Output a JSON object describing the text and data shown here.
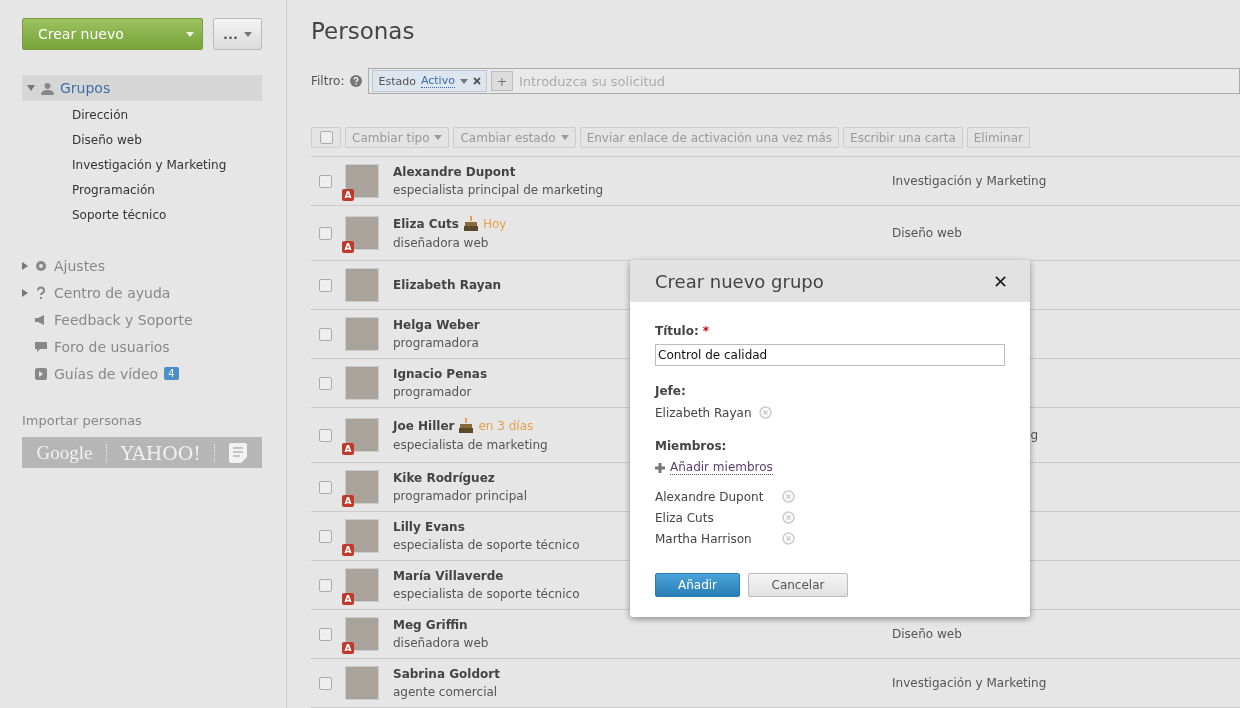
{
  "sidebar": {
    "create_button": "Crear nuevo",
    "more_button": "...",
    "groups": {
      "label": "Grupos",
      "expanded": true,
      "children": [
        {
          "label": "Dirección"
        },
        {
          "label": "Diseño web"
        },
        {
          "label": "Investigación y Marketing"
        },
        {
          "label": "Programación"
        },
        {
          "label": "Soporte técnico"
        }
      ]
    },
    "links": [
      {
        "kind": "settings",
        "label": "Ajustes",
        "expandable": true
      },
      {
        "kind": "help",
        "label": "Centro de ayuda",
        "expandable": true
      },
      {
        "kind": "feedback",
        "label": "Feedback y Soporte",
        "expandable": false
      },
      {
        "kind": "forum",
        "label": "Foro de usuarios",
        "expandable": false
      },
      {
        "kind": "video",
        "label": "Guías de vídeo",
        "expandable": false,
        "count": "4"
      }
    ],
    "import": {
      "label": "Importar personas",
      "sources": [
        "Google",
        "YAHOO!"
      ]
    }
  },
  "page": {
    "title": "Personas",
    "filter": {
      "label": "Filtro:",
      "tag": {
        "name": "Estado",
        "value": "Activo"
      },
      "add_button": "+",
      "placeholder": "Introduzca su solicitud"
    },
    "select_all": {
      "checked": false
    },
    "toolbar": [
      {
        "label": "Cambiar tipo",
        "dropdown": true
      },
      {
        "label": "Cambiar estado",
        "dropdown": true
      },
      {
        "label": "Enviar enlace de activación una vez más",
        "dropdown": false
      },
      {
        "label": "Escribir una carta",
        "dropdown": false
      },
      {
        "label": "Eliminar",
        "dropdown": false
      }
    ],
    "people": [
      {
        "name": "Alexandre Dupont",
        "role": "especialista principal de marketing",
        "badge": "A",
        "department": "Investigación y Marketing",
        "checked": false
      },
      {
        "name": "Eliza Cuts",
        "birthday": "Hoy",
        "role": "diseñadora web",
        "badge": "A",
        "department": "Diseño web",
        "checked": false
      },
      {
        "name": "Elizabeth Rayan",
        "checked": false
      },
      {
        "name": "Helga Weber",
        "role": "programadora",
        "checked": false
      },
      {
        "name": "Ignacio Penas",
        "role": "programador",
        "checked": false
      },
      {
        "name": "Joe Hiller",
        "birthday": "en 3 días",
        "role": "especialista de marketing",
        "badge": "A",
        "department": "g",
        "department_clipped": true,
        "checked": false
      },
      {
        "name": "Kike Rodríguez",
        "role": "programador principal",
        "badge": "A",
        "checked": false
      },
      {
        "name": "Lilly Evans",
        "role": "especialista de soporte técnico",
        "badge": "A",
        "checked": false
      },
      {
        "name": "María Villaverde",
        "role": "especialista de soporte técnico",
        "badge": "A",
        "checked": false
      },
      {
        "name": "Meg Griffin",
        "role": "diseñadora web",
        "badge": "A",
        "department": "Diseño web",
        "checked": false
      },
      {
        "name": "Sabrina Goldort",
        "role": "agente comercial",
        "department": "Investigación y Marketing",
        "checked": false
      }
    ]
  },
  "dialog": {
    "title": "Crear nuevo grupo",
    "close": "✕",
    "title_label": "Título:",
    "required_mark": "*",
    "title_value": "Control de calidad",
    "head_label": "Jefe:",
    "head": "Elizabeth Rayan",
    "members_label": "Miembros:",
    "add_members": "Añadir miembros",
    "members": [
      "Alexandre Dupont",
      "Eliza Cuts",
      "Martha Harrison"
    ],
    "buttons": [
      {
        "kind": "primary",
        "label": "Añadir"
      },
      {
        "kind": "secondary",
        "label": "Cancelar"
      }
    ]
  }
}
